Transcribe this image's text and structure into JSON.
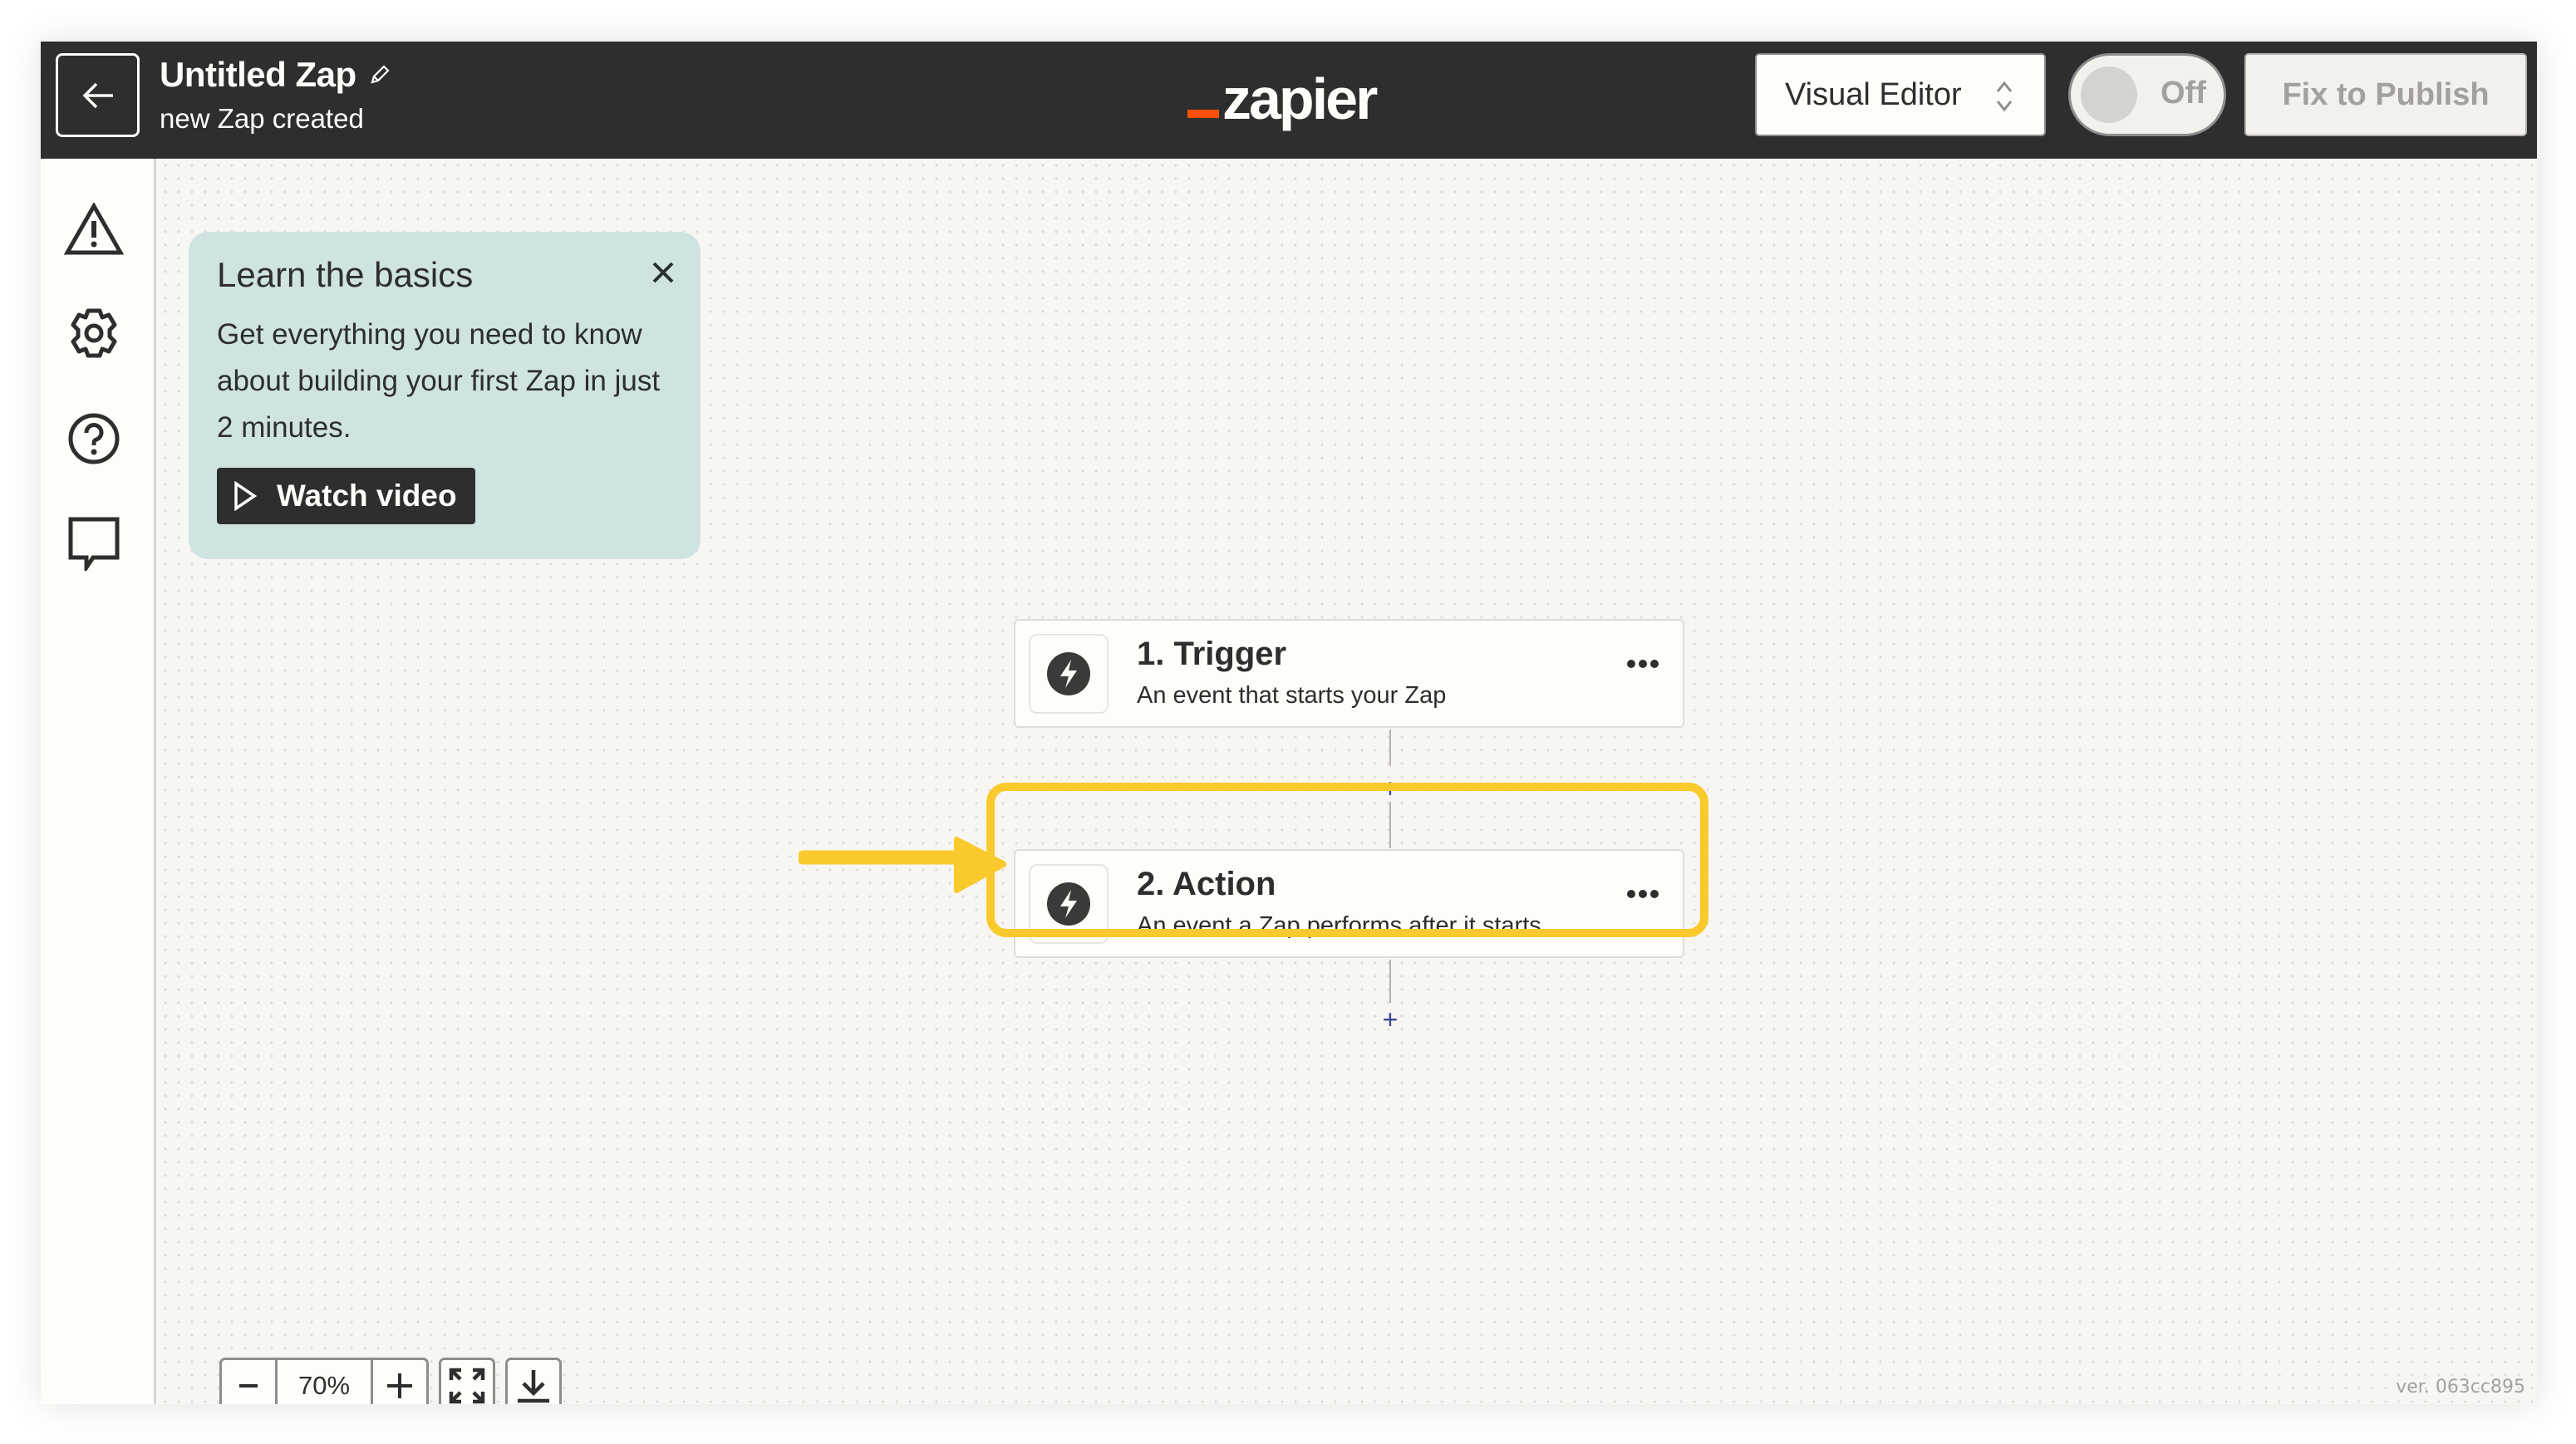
{
  "header": {
    "back_icon": "arrow-left-icon",
    "title": "Untitled Zap",
    "edit_icon": "pencil-icon",
    "subtitle": "new Zap created",
    "logo_text": "zapier",
    "logo_accent_color": "#ff4f00",
    "editor_select": {
      "value": "Visual Editor",
      "icon": "chevron-up-down-icon"
    },
    "toggle": {
      "label": "Off",
      "state": "off"
    },
    "publish_button": {
      "label": "Fix to Publish",
      "disabled": true
    }
  },
  "sidebar": {
    "items": [
      {
        "name": "warnings",
        "icon": "warning-icon"
      },
      {
        "name": "settings",
        "icon": "gear-icon"
      },
      {
        "name": "help",
        "icon": "help-icon"
      },
      {
        "name": "comments",
        "icon": "comment-icon"
      }
    ]
  },
  "learn_card": {
    "title": "Learn the basics",
    "close_icon": "close-icon",
    "body": "Get everything you need to know about building your first Zap in just 2 minutes.",
    "button_label": "Watch video",
    "button_icon": "play-icon",
    "background_color": "#cfe4e1"
  },
  "steps": [
    {
      "title": "1. Trigger",
      "description": "An event that starts your Zap",
      "icon": "bolt-icon",
      "more_icon": "more-horizontal-icon"
    },
    {
      "title": "2. Action",
      "description": "An event a Zap performs after it starts",
      "icon": "bolt-icon",
      "more_icon": "more-horizontal-icon",
      "highlighted": true
    }
  ],
  "add_step_label": "+",
  "annotation": {
    "highlight_color": "#fac92c",
    "arrow_icon": "arrow-right-icon"
  },
  "zoom_controls": {
    "zoom_out_icon": "minus-icon",
    "zoom_level": "70%",
    "zoom_in_icon": "plus-icon",
    "fit_icon": "fit-screen-icon",
    "download_icon": "download-icon"
  },
  "version": "ver. 063cc895"
}
